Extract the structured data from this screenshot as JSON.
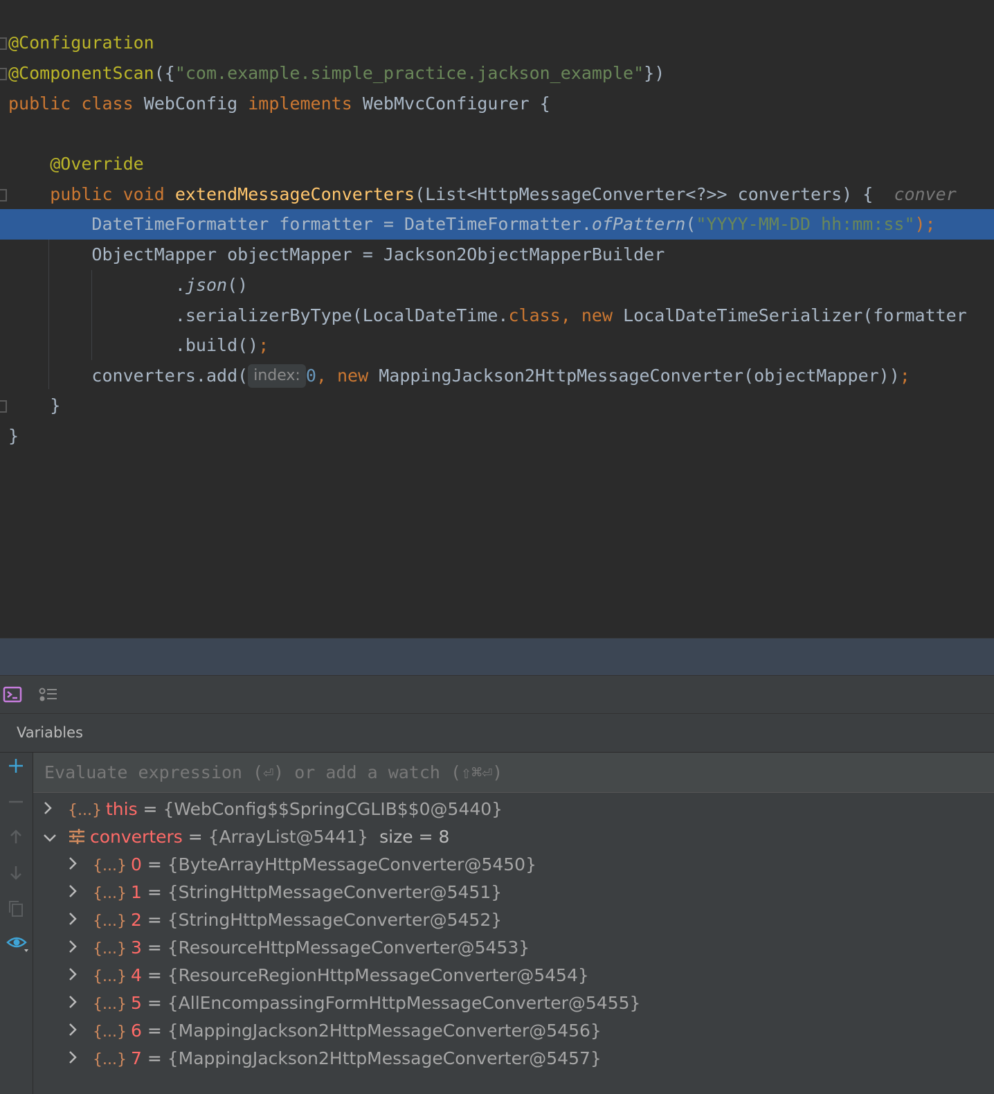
{
  "editor": {
    "code": {
      "l1": {
        "ann": "@Configuration"
      },
      "l2": {
        "ann": "@ComponentScan",
        "open": "({",
        "str": "\"com.example.simple_practice.jackson_example\"",
        "close": "})"
      },
      "l3": {
        "kw1": "public",
        "kw2": "class",
        "name": "WebConfig",
        "kw3": "implements",
        "iface": "WebMvcConfigurer",
        "brace": "{"
      },
      "l5": {
        "ann": "@Override"
      },
      "l6": {
        "kw1": "public",
        "kw2": "void",
        "fn": "extendMessageConverters",
        "params": "(List<HttpMessageConverter<?>> converters) {",
        "inlay": "conver"
      },
      "l7": {
        "a": "DateTimeFormatter formatter = DateTimeFormatter.",
        "b": "ofPattern",
        "c": "(",
        "str": "\"YYYY-MM-DD hh:mm:ss\"",
        "d": ");"
      },
      "l8": {
        "text": "ObjectMapper objectMapper = Jackson2ObjectMapperBuilder"
      },
      "l9": {
        "dot": ".",
        "fn": "json",
        "paren": "()"
      },
      "l10": {
        "a": ".serializerByType(LocalDateTime.",
        "kw1": "class",
        "comma": ",",
        "kw2": "new",
        "b": "LocalDateTimeSerializer(formatter"
      },
      "l11": {
        "a": ".build()",
        "semi": ";"
      },
      "l12": {
        "a": "converters.add(",
        "hint": "index:",
        "num": "0",
        "comma": ",",
        "kw": "new",
        "b": "MappingJackson2HttpMessageConverter(objectMapper))",
        "semi": ";"
      },
      "l13": {
        "brace": "}"
      },
      "l14": {
        "brace": "}"
      }
    }
  },
  "debugger": {
    "panel_title": "Variables",
    "eval_placeholder": "Evaluate expression (⏎) or add a watch (⇧⌘⏎)",
    "variables": [
      {
        "name": "this",
        "value": "{WebConfig$$SpringCGLIB$$0@5440}",
        "extra": "",
        "expanded": false,
        "level": 0,
        "icon": "object-icon"
      },
      {
        "name": "converters",
        "value": "{ArrayList@5441}",
        "extra": "size = 8",
        "expanded": true,
        "level": 0,
        "icon": "list-icon"
      },
      {
        "name": "0",
        "value": "{ByteArrayHttpMessageConverter@5450}",
        "extra": "",
        "expanded": false,
        "level": 1,
        "icon": "object-icon"
      },
      {
        "name": "1",
        "value": "{StringHttpMessageConverter@5451}",
        "extra": "",
        "expanded": false,
        "level": 1,
        "icon": "object-icon"
      },
      {
        "name": "2",
        "value": "{StringHttpMessageConverter@5452}",
        "extra": "",
        "expanded": false,
        "level": 1,
        "icon": "object-icon"
      },
      {
        "name": "3",
        "value": "{ResourceHttpMessageConverter@5453}",
        "extra": "",
        "expanded": false,
        "level": 1,
        "icon": "object-icon"
      },
      {
        "name": "4",
        "value": "{ResourceRegionHttpMessageConverter@5454}",
        "extra": "",
        "expanded": false,
        "level": 1,
        "icon": "object-icon"
      },
      {
        "name": "5",
        "value": "{AllEncompassingFormHttpMessageConverter@5455}",
        "extra": "",
        "expanded": false,
        "level": 1,
        "icon": "object-icon"
      },
      {
        "name": "6",
        "value": "{MappingJackson2HttpMessageConverter@5456}",
        "extra": "",
        "expanded": false,
        "level": 1,
        "icon": "object-icon"
      },
      {
        "name": "7",
        "value": "{MappingJackson2HttpMessageConverter@5457}",
        "extra": "",
        "expanded": false,
        "level": 1,
        "icon": "object-icon"
      }
    ],
    "icons": {
      "object": "{...}",
      "chevron_right": "›",
      "chevron_down": "⌄"
    }
  },
  "colors": {
    "editor_bg": "#2b2b2b",
    "highlight_line": "#2d5c9b",
    "annotation": "#bbb529",
    "keyword": "#cc7832",
    "string": "#6a8759",
    "function": "#ffc66d",
    "number": "#6897bb",
    "var_name": "#ff6b68"
  }
}
